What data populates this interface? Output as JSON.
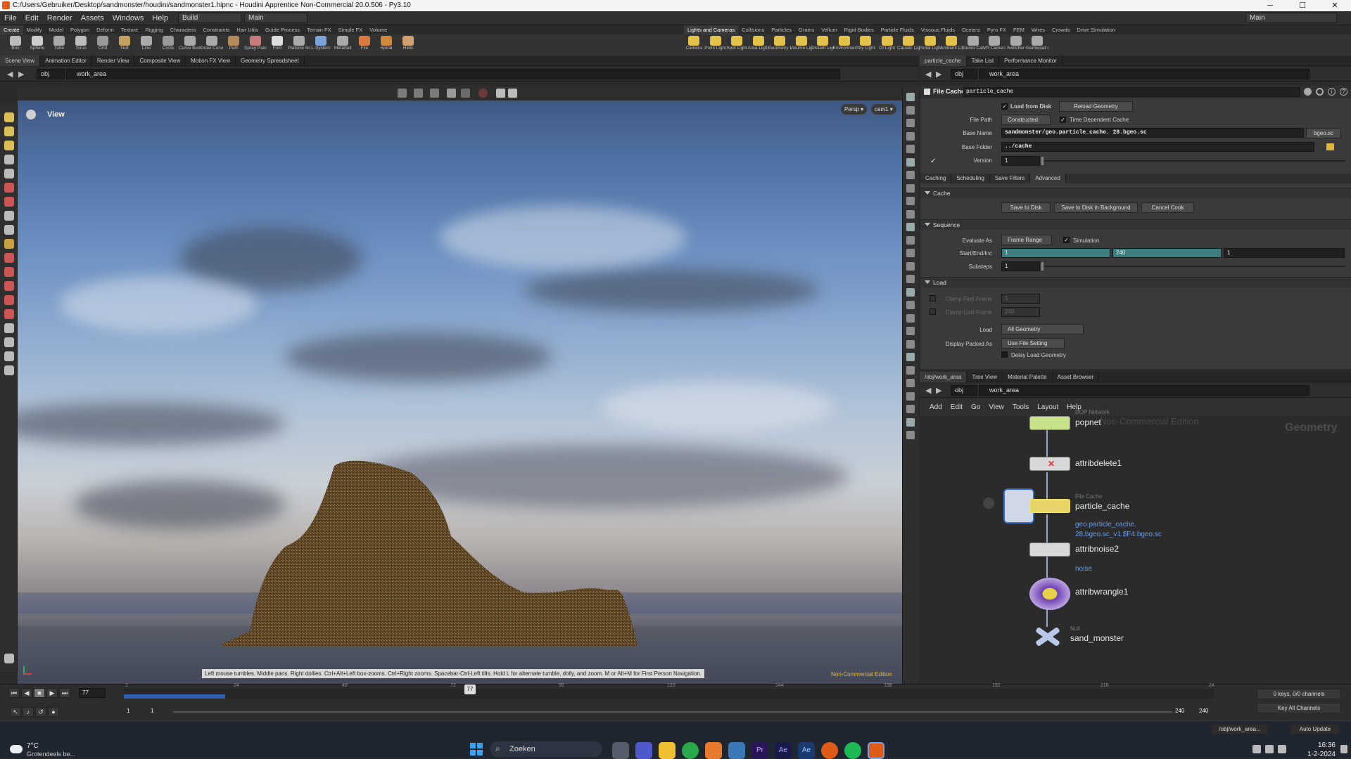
{
  "titlebar": {
    "title": "C:/Users/Gebruiker/Desktop/sandmonster/houdini/sandmonster1.hipnc - Houdini Apprentice Non-Commercial 20.0.506 - Py3.10",
    "minimize": "─",
    "maximize": "☐",
    "close": "✕"
  },
  "menubar": {
    "items": [
      "File",
      "Edit",
      "Render",
      "Assets",
      "Windows",
      "Help"
    ],
    "desktop": "Build",
    "desktop2": "Main",
    "right_desktop": "Main"
  },
  "shelf_left": {
    "tabs": [
      "Create",
      "Modify",
      "Model",
      "Polygon",
      "Deform",
      "Texture",
      "Rigging",
      "Characters",
      "Constraints",
      "Hair Utils",
      "Guide Process",
      "Terrain FX",
      "Simple FX",
      "Volume"
    ],
    "tools": [
      "Box",
      "Sphere",
      "Tube",
      "Torus",
      "Grid",
      "Null",
      "Line",
      "Circle",
      "Curve Bezier",
      "Draw Curve",
      "Path",
      "Spray Paint",
      "Font",
      "Platonic Solids",
      "L-System",
      "Metaball",
      "File",
      "Spiral",
      "Helix"
    ]
  },
  "shelf_right": {
    "tabs": [
      "Lights and Cameras",
      "Collisions",
      "Particles",
      "Grains",
      "Vellum",
      "Rigid Bodies",
      "Particle Fluids",
      "Viscous Fluids",
      "Oceans",
      "Pyro FX",
      "FEM",
      "Wires",
      "Crowds",
      "Drive Simulation"
    ],
    "tools": [
      "Camera",
      "Point Light",
      "Spot Light",
      "Area Light",
      "Geometry Light",
      "Volume Light",
      "Distant Light",
      "Environment Light",
      "Sky Light",
      "GI Light",
      "Caustic Light",
      "Portal Light",
      "Ambient Light",
      "Stereo Camera",
      "VR Camera",
      "Switcher",
      "Gamepad Camera"
    ]
  },
  "viewer": {
    "tabs": [
      "Scene View",
      "Animation Editor",
      "Render View",
      "Composite View",
      "Motion FX View",
      "Geometry Spreadsheet"
    ],
    "path_root": "obj",
    "path_node": "work_area",
    "title": "View",
    "persp": "Persp ▾",
    "cam": "cam1 ▾",
    "hint": "Left mouse tumbles. Middle pans. Right dollies. Ctrl+Alt+Left box-zooms. Ctrl+Right zooms. Spacebar-Ctrl-Left tilts. Hold L for alternate tumble, dolly, and zoom. M or Alt+M for First Person Navigation.",
    "watermark": "Non-Commercial Edition"
  },
  "params": {
    "tabs": [
      "particle_cache",
      "Take List",
      "Performance Monitor"
    ],
    "path_root": "obj",
    "path_node": "work_area",
    "node_type": "File Cache",
    "node_name": "particle_cache",
    "load_from_disk": "Load from Disk",
    "reload_geometry": "Reload Geometry",
    "file_path_label": "File Path",
    "file_path_value": "Constructed",
    "time_dependent": "Time Dependent Cache",
    "base_name_label": "Base Name",
    "base_name_value": "sandmonster/geo.particle_cache. 28.bgeo.sc",
    "ext": "bgeo.sc",
    "base_folder_label": "Base Folder",
    "base_folder_value": "../cache",
    "version_label": "Version",
    "version_value": "1",
    "subtabs": [
      "Caching",
      "Scheduling",
      "Save Filters",
      "Advanced"
    ],
    "cache_section": "Cache",
    "save_to_disk": "Save to Disk",
    "save_bg": "Save to Disk in Background",
    "cancel_cook": "Cancel Cook",
    "sequence_section": "Sequence",
    "evaluate_as_label": "Evaluate As",
    "evaluate_as_value": "Frame Range",
    "simulation": "Simulation",
    "start_end_label": "Start/End/Inc",
    "start": "1",
    "end": "240",
    "inc": "1",
    "substeps_label": "Substeps",
    "substeps_value": "1",
    "load_section": "Load",
    "clamp_first_label": "Clamp First Frame",
    "clamp_first_value": "1",
    "clamp_last_label": "Clamp Last Frame",
    "clamp_last_value": "240",
    "load_label": "Load",
    "load_value": "All Geometry",
    "display_packed_label": "Display Packed As",
    "display_packed_value": "Use File Setting",
    "delay_load": "Delay Load Geometry"
  },
  "network": {
    "tabs": [
      "/obj/work_area",
      "Tree View",
      "Material Palette",
      "Asset Browser"
    ],
    "path_root": "obj",
    "path_node": "work_area",
    "menu": [
      "Add",
      "Edit",
      "Go",
      "View",
      "Tools",
      "Layout",
      "Help"
    ],
    "watermark": "Non-Commercial Edition",
    "context": "Geometry",
    "nodes": [
      {
        "name": "popnet",
        "type": "DOP Network"
      },
      {
        "name": "attribdelete1",
        "type": ""
      },
      {
        "name": "particle_cache",
        "type": "File Cache",
        "sub": "geo.particle_cache.",
        "sub2": "28.bgeo.sc_v1.$F4.bgeo.sc"
      },
      {
        "name": "attribnoise2",
        "type": "",
        "sub": "noise"
      },
      {
        "name": "attribwrangle1",
        "type": ""
      },
      {
        "name": "sand_monster",
        "type": "Null"
      }
    ]
  },
  "timeline": {
    "frame": "77",
    "marker": "77",
    "ticks": [
      "1",
      "24",
      "48",
      "72",
      "96",
      "120",
      "144",
      "168",
      "192",
      "216",
      "24"
    ],
    "range_start": "1",
    "range_start2": "1",
    "range_end": "240",
    "range_end2": "240",
    "keys": "0 keys, 0/0 channels",
    "key_all": "Key All Channels",
    "auto_update": "Auto Update",
    "path": "/obj/work_area..."
  },
  "taskbar": {
    "temp": "7°C",
    "weather": "Grotendeels be...",
    "search": "Zoeken",
    "time": "16:36",
    "date": "1-2-2024"
  },
  "colors": {
    "accent": "#e05a1a",
    "sand": "#6b4e22",
    "teal": "#3b7e7d",
    "node_yellow": "#e6d36a",
    "node_blue": "#2d5fb0",
    "link": "#6c9be0"
  }
}
